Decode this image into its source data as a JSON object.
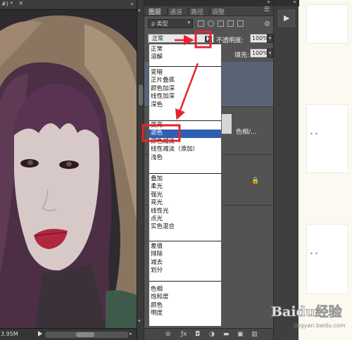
{
  "document": {
    "tab_title": "#) * ",
    "tab_close": "×",
    "tab_arrow": "»",
    "status_doc_size": "3.95M"
  },
  "layers_panel": {
    "tabs": [
      {
        "label": "图层",
        "active": true
      },
      {
        "label": "通道",
        "active": false
      },
      {
        "label": "路径",
        "active": false
      },
      {
        "label": "调整",
        "active": false
      }
    ],
    "filter_kind_label": "ρ 类型",
    "blend_mode_value": "正常",
    "opacity_label": "不透明度:",
    "opacity_value": "100%",
    "fill_label": "填充:",
    "fill_value": "100%",
    "mid_layer_name": "色相/...",
    "lock_icon": "🔒"
  },
  "blend_dropdown": {
    "groups": [
      [
        "正常",
        "溶解"
      ],
      [
        "变暗",
        "正片叠底",
        "颜色加深",
        "线性加深",
        "深色"
      ],
      [
        "变亮",
        "滤色",
        "颜色减淡",
        "线性减淡（添加）",
        "浅色"
      ],
      [
        "叠加",
        "柔光",
        "强光",
        "亮光",
        "线性光",
        "点光",
        "实色混合"
      ],
      [
        "差值",
        "排除",
        "减去",
        "划分"
      ],
      [
        "色相",
        "饱和度",
        "颜色",
        "明度"
      ]
    ],
    "selected": "滤色"
  },
  "annotation_color": "#e8232d",
  "selection_color": "#2e5fb3",
  "dock": {
    "collapse_glyph": "«",
    "play_glyph": "▶"
  },
  "watermark": {
    "brand": "Baidu经验",
    "url": "jingyan.baidu.com"
  }
}
